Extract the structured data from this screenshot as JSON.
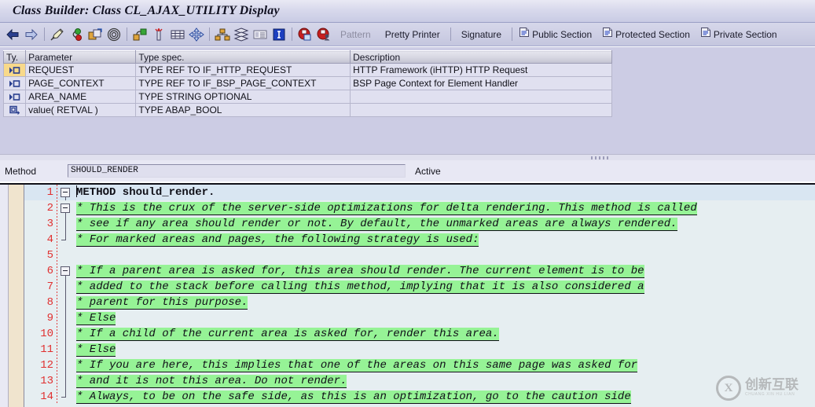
{
  "window": {
    "title": "Class Builder: Class CL_AJAX_UTILITY Display"
  },
  "toolbar": {
    "icons": [
      {
        "name": "back-arrow-icon",
        "glyph": "←"
      },
      {
        "name": "forward-arrow-icon",
        "glyph": "→"
      },
      {
        "name": "check-syntax-icon",
        "glyph": "✎"
      },
      {
        "name": "activate-icon",
        "glyph": "●"
      },
      {
        "name": "copy-object-icon",
        "glyph": "❐"
      },
      {
        "name": "where-used-icon",
        "glyph": "◎"
      },
      {
        "name": "display-object-list-icon",
        "glyph": "⧉"
      },
      {
        "name": "insert-statement-icon",
        "glyph": "✱"
      },
      {
        "name": "table-icon",
        "glyph": "⌸"
      },
      {
        "name": "navigate-icon",
        "glyph": "✥"
      },
      {
        "name": "class-hierarchy-icon",
        "glyph": "⑂"
      },
      {
        "name": "inheritance-icon",
        "glyph": "≡"
      },
      {
        "name": "attribute-list-icon",
        "glyph": "☷"
      },
      {
        "name": "info-icon",
        "glyph": "I"
      },
      {
        "name": "redefine-icon",
        "glyph": "⬜"
      },
      {
        "name": "exception-icon",
        "glyph": "⚠"
      }
    ],
    "pattern_label": "Pattern",
    "pretty_printer_label": "Pretty Printer",
    "signature_label": "Signature",
    "public_section_label": "Public Section",
    "protected_section_label": "Protected Section",
    "private_section_label": "Private Section"
  },
  "parameters": {
    "columns": [
      "Ty.",
      "Parameter",
      "Type spec.",
      "Description"
    ],
    "rows": [
      {
        "ty": "importing",
        "parameter": "REQUEST",
        "type": "TYPE REF TO IF_HTTP_REQUEST",
        "description": "HTTP Framework (iHTTP) HTTP Request",
        "selected": true
      },
      {
        "ty": "importing",
        "parameter": "PAGE_CONTEXT",
        "type": "TYPE REF TO IF_BSP_PAGE_CONTEXT",
        "description": "BSP Page Context for Element Handler",
        "selected": false
      },
      {
        "ty": "importing",
        "parameter": "AREA_NAME",
        "type": "TYPE STRING OPTIONAL",
        "description": "",
        "selected": false
      },
      {
        "ty": "returning",
        "parameter": "value( RETVAL )",
        "type": "TYPE ABAP_BOOL",
        "description": "",
        "selected": false
      }
    ]
  },
  "method_bar": {
    "label": "Method",
    "value": "SHOULD_RENDER",
    "placeholder": "",
    "status": "Active"
  },
  "editor": {
    "lines": [
      {
        "num": "1",
        "fold": "box-start",
        "kind": "code",
        "text": "METHOD should_render.",
        "caret": true
      },
      {
        "num": "2",
        "fold": "box-start",
        "kind": "comment",
        "text": "* This is the crux of the server-side optimizations for delta rendering. This method is called"
      },
      {
        "num": "3",
        "fold": "line",
        "kind": "comment",
        "text": "* see if any area should render or not. By default, the unmarked areas are always rendered."
      },
      {
        "num": "4",
        "fold": "line-end",
        "kind": "comment",
        "text": "* For marked areas and pages, the following strategy is used:"
      },
      {
        "num": "5",
        "fold": "none",
        "kind": "blank",
        "text": ""
      },
      {
        "num": "6",
        "fold": "box-start",
        "kind": "comment",
        "text": "*   If a parent area is asked for, this area should render. The current element is to be"
      },
      {
        "num": "7",
        "fold": "line",
        "kind": "comment",
        "text": "*   added to the stack before calling this method, implying that it is also considered a"
      },
      {
        "num": "8",
        "fold": "line",
        "kind": "comment",
        "text": "*   parent for this purpose."
      },
      {
        "num": "9",
        "fold": "line",
        "kind": "comment",
        "text": "*   Else"
      },
      {
        "num": "10",
        "fold": "line",
        "kind": "comment",
        "text": "*   If a child of the current area is asked for, render this area."
      },
      {
        "num": "11",
        "fold": "line",
        "kind": "comment",
        "text": "*   Else"
      },
      {
        "num": "12",
        "fold": "line",
        "kind": "comment",
        "text": "*   If you are here, this implies that one of the areas on this same page was asked for"
      },
      {
        "num": "13",
        "fold": "line",
        "kind": "comment",
        "text": "*   and it is not this area. Do not render."
      },
      {
        "num": "14",
        "fold": "line-end",
        "kind": "comment",
        "text": "*   Always, to be on the safe side, as this is an optimization, go to the caution side"
      }
    ]
  },
  "watermark": {
    "letter": "X",
    "chinese": "创新互联",
    "pinyin": "CHUANG XIN HU LIAN"
  },
  "colors": {
    "title_bar": "#d8d9ec",
    "toolbar": "#cdcee4",
    "panel": "#ccccE4",
    "comment_highlight": "#96f396",
    "line_number": "#e03030",
    "selected_row": "#f8d98a",
    "editor_bg": "#e6eef1",
    "current_line": "#d9e6f2"
  }
}
